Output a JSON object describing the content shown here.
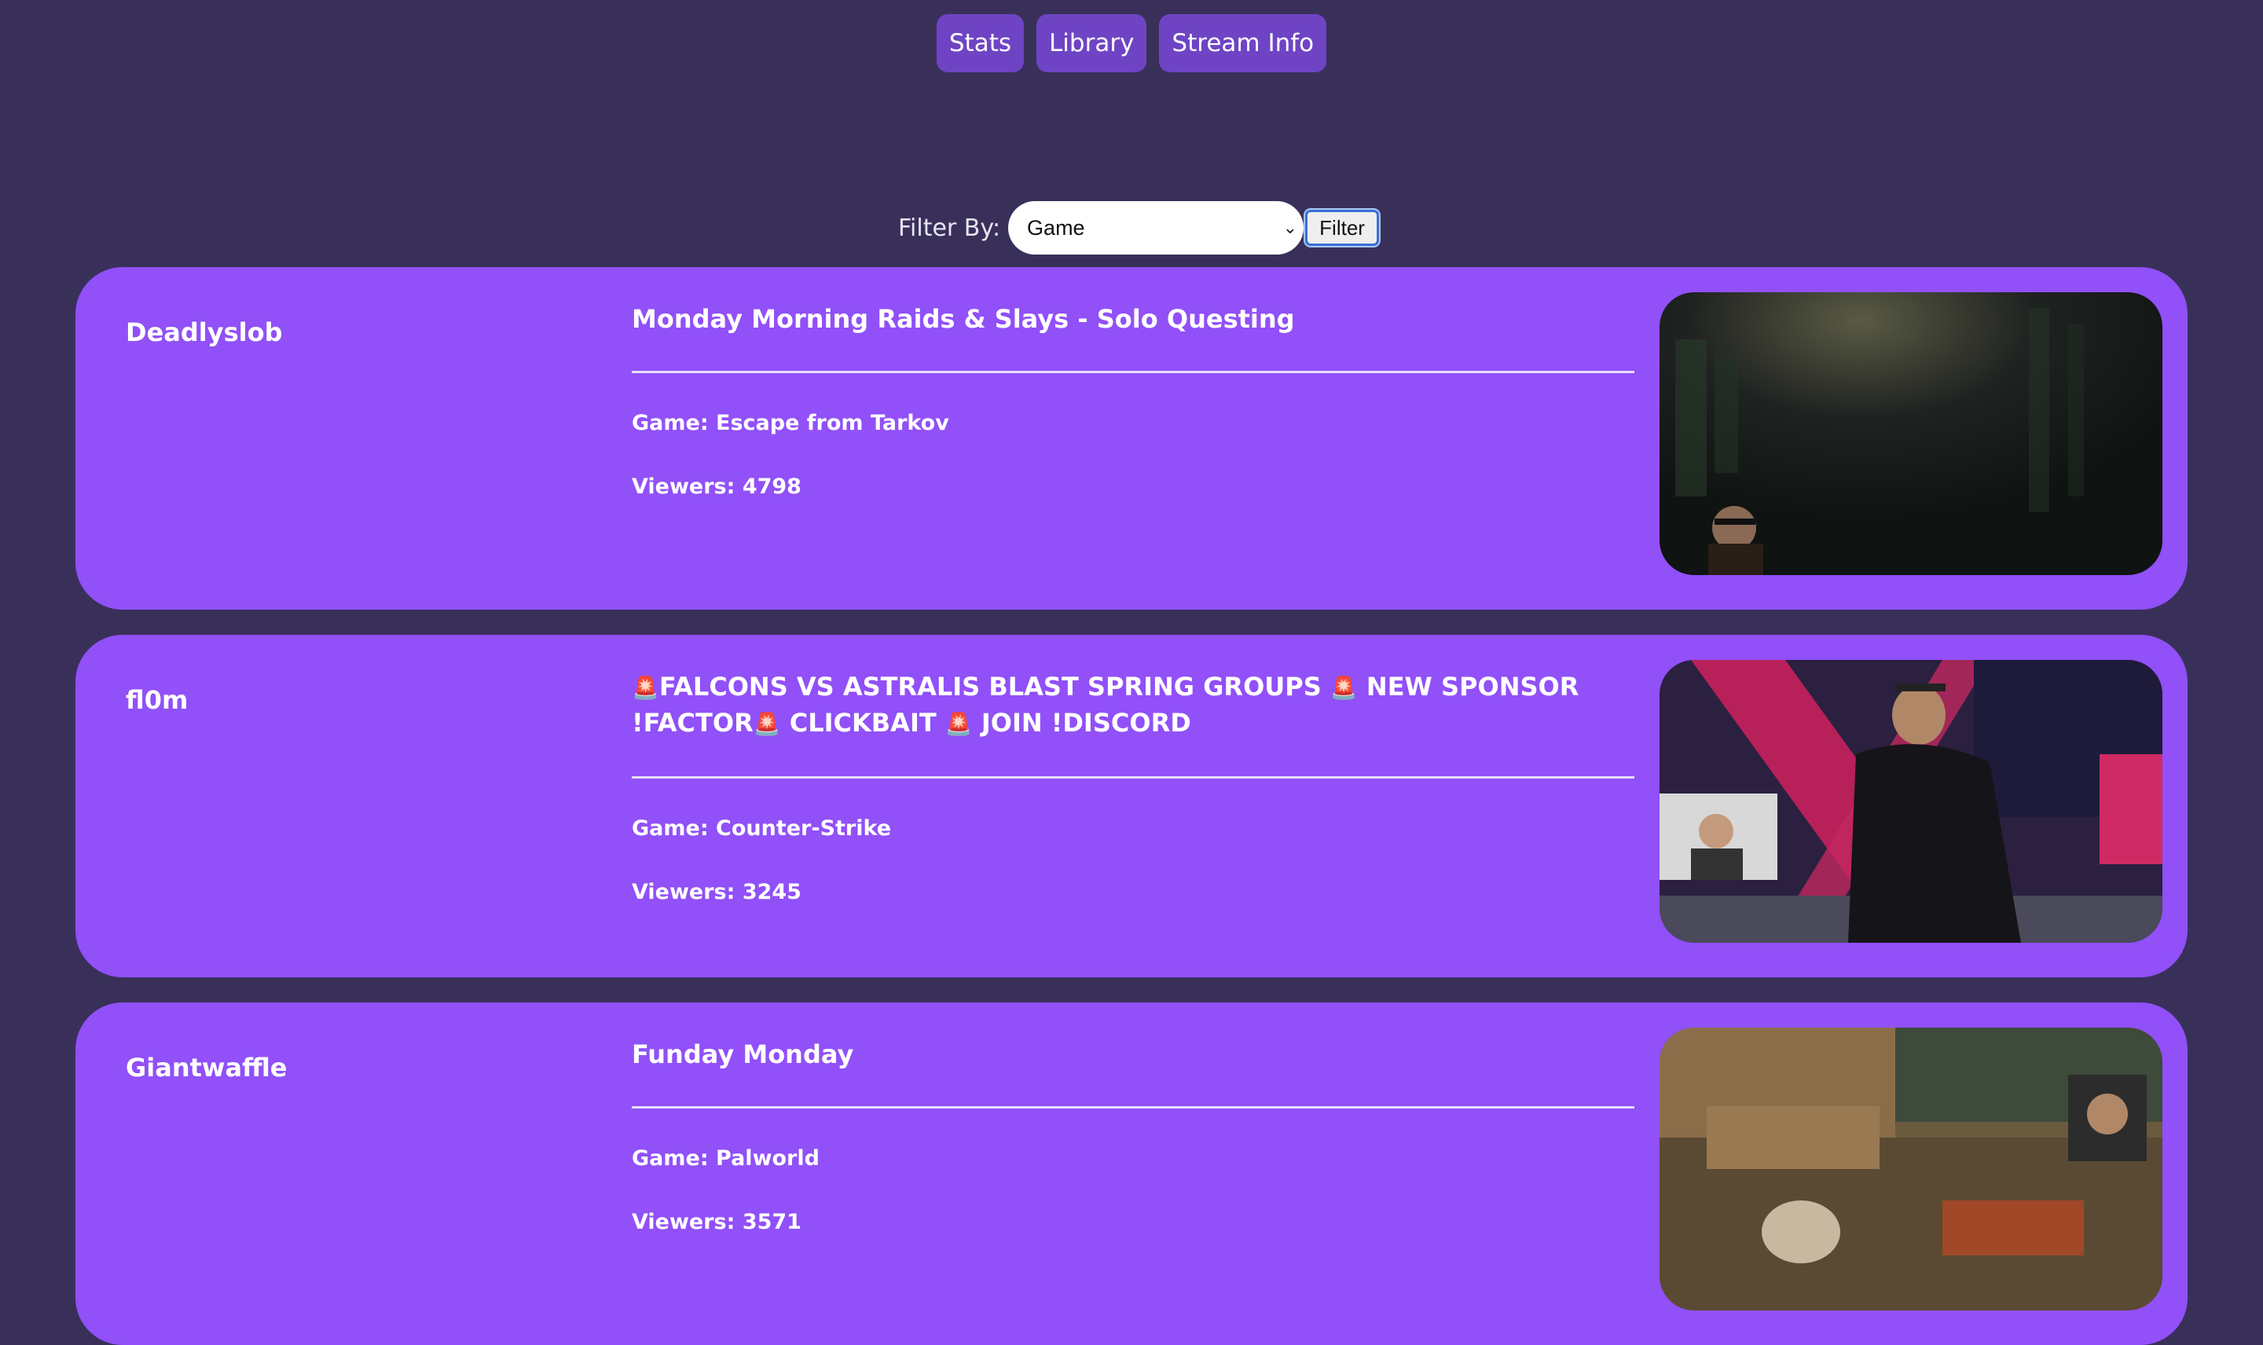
{
  "nav": {
    "stats_label": "Stats",
    "library_label": "Library",
    "stream_info_label": "Stream Info"
  },
  "filter": {
    "label": "Filter By:",
    "selected_option": "Game",
    "button_label": "Filter"
  },
  "streams": [
    {
      "user": "Deadlyslob",
      "title": "Monday Morning Raids & Slays - Solo Questing",
      "game": "Game: Escape from Tarkov",
      "viewers": "Viewers: 4798"
    },
    {
      "user": "fl0m",
      "title_parts": [
        "FALCONS VS ASTRALIS BLAST SPRING GROUPS",
        "NEW SPONSOR !FACTOR",
        "CLICKBAIT",
        "JOIN !DISCORD"
      ],
      "title_icon": "siren-emoji",
      "game": "Game: Counter-Strike",
      "viewers": "Viewers: 3245"
    },
    {
      "user": "Giantwaffle",
      "title": "Funday Monday",
      "game": "Game: Palworld",
      "viewers": "Viewers: 3571"
    }
  ],
  "colors": {
    "background": "#39305a",
    "card": "#9150f8",
    "nav_button": "#6e44c4"
  }
}
